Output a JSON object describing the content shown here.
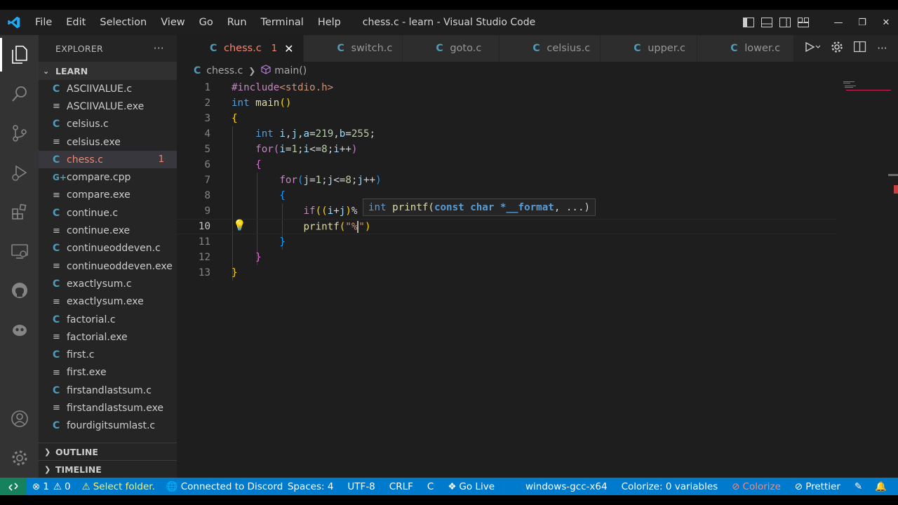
{
  "window": {
    "title": "chess.c - learn - Visual Studio Code",
    "menu": [
      "File",
      "Edit",
      "Selection",
      "View",
      "Go",
      "Run",
      "Terminal",
      "Help"
    ]
  },
  "sidebar": {
    "header": "EXPLORER",
    "more": "···",
    "folder": "LEARN",
    "files": [
      {
        "name": "ASCIIVALUE.c",
        "type": "c"
      },
      {
        "name": "ASCIIVALUE.exe",
        "type": "exe"
      },
      {
        "name": "celsius.c",
        "type": "c"
      },
      {
        "name": "celsius.exe",
        "type": "exe"
      },
      {
        "name": "chess.c",
        "type": "c",
        "active": true,
        "badge": "1"
      },
      {
        "name": "compare.cpp",
        "type": "cpp"
      },
      {
        "name": "compare.exe",
        "type": "exe"
      },
      {
        "name": "continue.c",
        "type": "c"
      },
      {
        "name": "continue.exe",
        "type": "exe"
      },
      {
        "name": "continueoddeven.c",
        "type": "c"
      },
      {
        "name": "continueoddeven.exe",
        "type": "exe"
      },
      {
        "name": "exactlysum.c",
        "type": "c"
      },
      {
        "name": "exactlysum.exe",
        "type": "exe"
      },
      {
        "name": "factorial.c",
        "type": "c"
      },
      {
        "name": "factorial.exe",
        "type": "exe"
      },
      {
        "name": "first.c",
        "type": "c"
      },
      {
        "name": "first.exe",
        "type": "exe"
      },
      {
        "name": "firstandlastsum.c",
        "type": "c"
      },
      {
        "name": "firstandlastsum.exe",
        "type": "exe"
      },
      {
        "name": "fourdigitsumlast.c",
        "type": "c"
      }
    ],
    "outline": "OUTLINE",
    "timeline": "TIMELINE"
  },
  "tabs": [
    {
      "label": "chess.c",
      "active": true,
      "modified": "1"
    },
    {
      "label": "switch.c"
    },
    {
      "label": "goto.c"
    },
    {
      "label": "celsius.c"
    },
    {
      "label": "upper.c"
    },
    {
      "label": "lower.c"
    }
  ],
  "breadcrumb": {
    "file": "chess.c",
    "symbol": "main()"
  },
  "editor": {
    "line_numbers": [
      "1",
      "2",
      "3",
      "4",
      "5",
      "6",
      "7",
      "8",
      "9",
      "10",
      "11",
      "12",
      "13"
    ],
    "current_line": "10",
    "lines": [
      "#include<stdio.h>",
      "int main()",
      "{",
      "    int i,j,a=219,b=255;",
      "    for(i=1;i<=8;i++)",
      "    {",
      "        for(j=1;j<=8;j++)",
      "        {",
      "            if((i+j)%",
      "            printf(\"%\")",
      "        }",
      "    }",
      "}"
    ],
    "hint": {
      "ret": "int",
      "fn": "printf(",
      "param": "const char *__format",
      "rest": ", ...)"
    }
  },
  "status": {
    "errors": "1",
    "warnings": "0",
    "select_folder": "Select folder.",
    "discord": "Connected to Discord",
    "spaces": "Spaces: 4",
    "encoding": "UTF-8",
    "eol": "CRLF",
    "language": "C",
    "golive": "Go Live",
    "compiler": "windows-gcc-x64",
    "colorize_vars": "Colorize: 0 variables",
    "colorize": "Colorize",
    "prettier": "Prettier"
  },
  "colors": {
    "accent": "#007acc",
    "error": "#f48771",
    "c_icon": "#519aba"
  }
}
